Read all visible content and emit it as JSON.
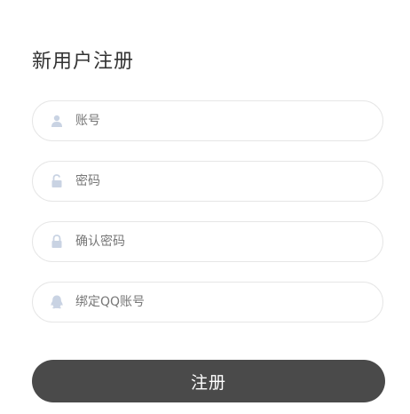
{
  "form": {
    "title": "新用户注册",
    "fields": [
      {
        "icon": "user-icon",
        "placeholder": "账号",
        "value": ""
      },
      {
        "icon": "unlock-icon",
        "placeholder": "密码",
        "value": ""
      },
      {
        "icon": "lock-icon",
        "placeholder": "确认密码",
        "value": ""
      },
      {
        "icon": "qq-icon",
        "placeholder": "绑定QQ账号",
        "value": ""
      }
    ],
    "submit_label": "注册"
  },
  "colors": {
    "icon": "#c9d3e3",
    "button": "#4a4a4a",
    "border": "#e6e6e6"
  }
}
